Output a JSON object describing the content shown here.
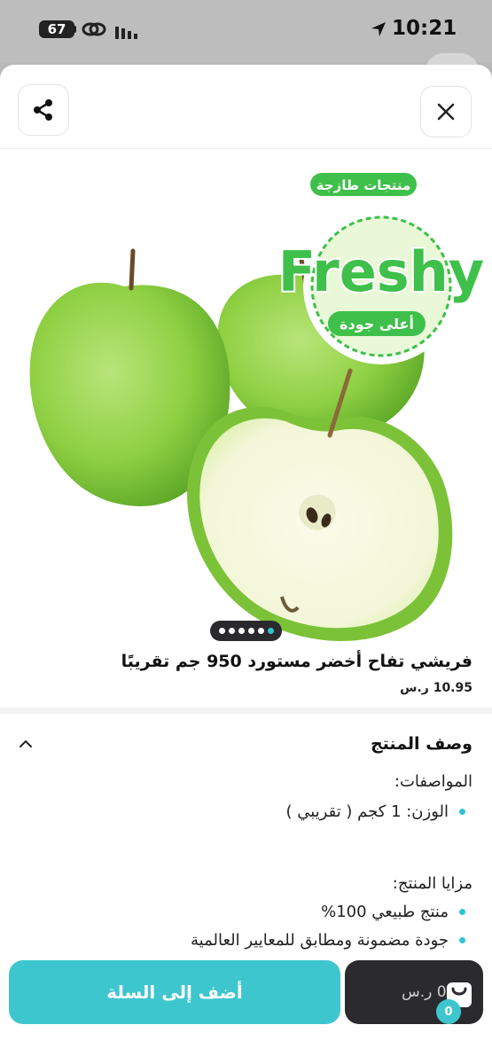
{
  "status_bar": {
    "battery": "67",
    "time": "10:21"
  },
  "header": {
    "share_icon": "share-icon",
    "close_icon": "close-icon"
  },
  "brand_logo": {
    "top_text": "منتجات طازجة",
    "name": "Freshy",
    "bottom_text": "أعلى جودة",
    "color": "#3ec04a"
  },
  "pager": {
    "count": 6,
    "active_index": 5
  },
  "product": {
    "title": "فريشي تفاح أخضر مستورد 950 جم تقريبًا",
    "price": "10.95",
    "currency_symbol": "ر.س"
  },
  "description": {
    "section_title": "وصف المنتج",
    "specs_heading": "المواصفات:",
    "specs": [
      "الوزن:  1 كجم ( تقريبي )"
    ],
    "features_heading": "مزايا المنتج:",
    "features": [
      "منتج طبيعي 100%",
      "جودة مضمونة ومطابق للمعايير العالمية"
    ]
  },
  "bottom_bar": {
    "add_to_cart_label": "أضف إلى السلة",
    "cart_total": "0",
    "cart_currency": "ر.س",
    "cart_count": "0",
    "accent_color": "#3ec6cf"
  }
}
